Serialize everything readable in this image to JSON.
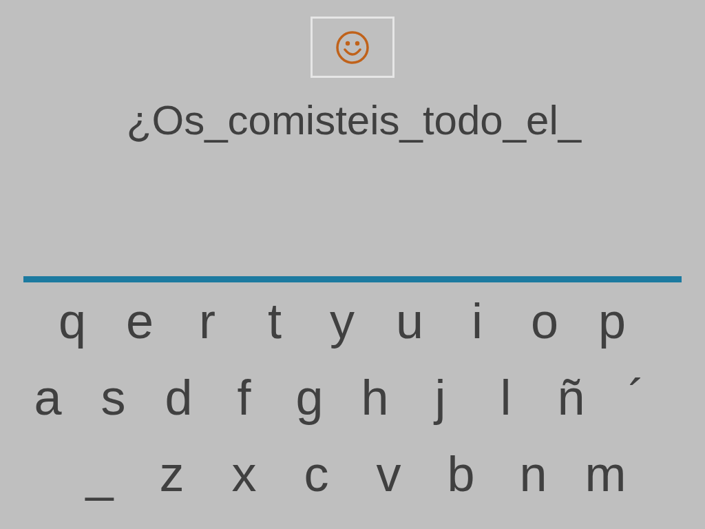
{
  "prompt": "¿Os_comisteis_todo_el_",
  "keyboard": {
    "rows": [
      [
        "q",
        "e",
        "r",
        "t",
        "y",
        "u",
        "i",
        "o",
        "p"
      ],
      [
        "a",
        "s",
        "d",
        "f",
        "g",
        "h",
        "j",
        "l",
        "ñ",
        "´"
      ],
      [
        "_",
        "z",
        "x",
        "c",
        "v",
        "b",
        "n",
        "m"
      ]
    ]
  }
}
